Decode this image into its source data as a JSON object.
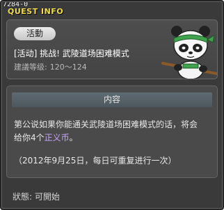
{
  "window": {
    "id": "7284-0",
    "title": "QUEST INFO"
  },
  "header": {
    "category": "活動",
    "quest_name": "[活动] 挑战! 武陵道场困难模式",
    "level_label": "建議等级:",
    "level_range": "120～124",
    "npc_icon": "panda-npc-icon"
  },
  "content": {
    "heading": "内容",
    "description_line1": "第公说如果你能通关武陵道场困难模式的话，将会",
    "description_line2_prefix": "给你4个",
    "reward_item": "正义币",
    "description_line2_suffix": "。",
    "note": "（2012年9月25日，每日可重复进行一次）"
  },
  "status": {
    "label": "狀態:",
    "value": "可開始"
  },
  "colors": {
    "title": "#f2dc4a",
    "reward_highlight": "#c9a6ff",
    "window_bg": "#3a3a3a"
  }
}
